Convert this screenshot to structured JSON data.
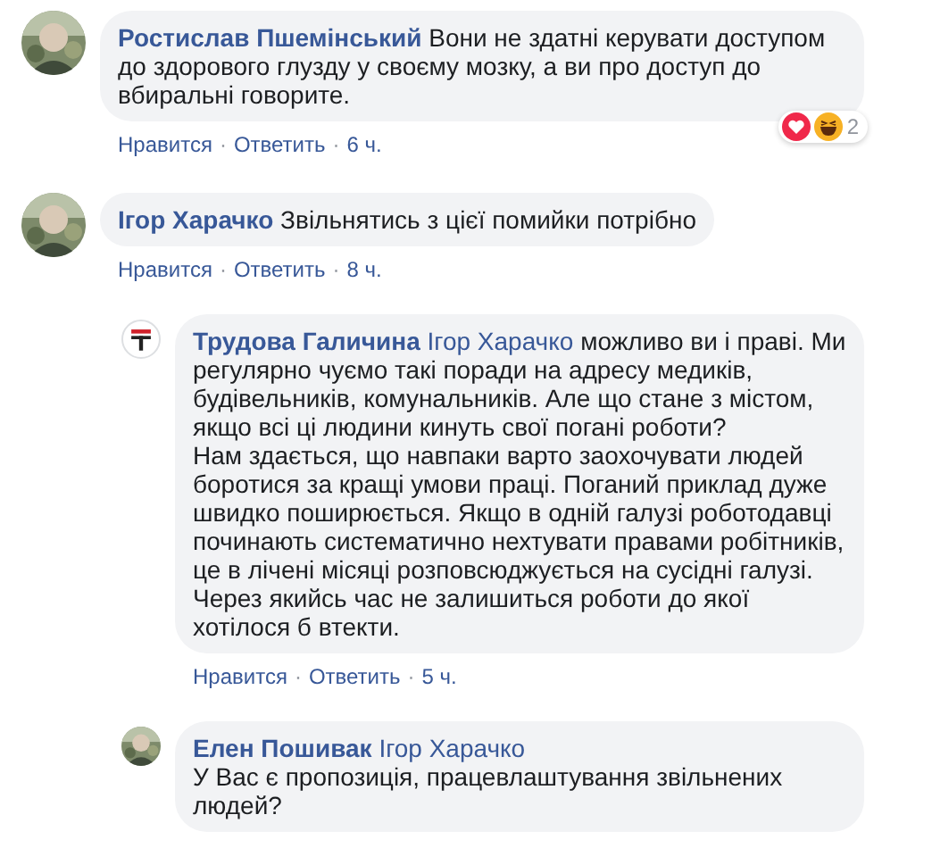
{
  "comments": [
    {
      "author": "Ростислав Пшемінський",
      "avatar": {
        "kind": "picture"
      },
      "paragraphs": [
        "Вони не здатні керувати доступом до здорового глузду у своєму мозку, а ви про доступ до вбиральні говорите."
      ],
      "actions": [
        "Нравится",
        "Ответить"
      ],
      "separator": "·",
      "time": "6 ч.",
      "reactions": {
        "count": "2"
      }
    },
    {
      "author": "Ігор Харачко",
      "avatar": {
        "kind": "picture"
      },
      "paragraphs": [
        "Звільнятись з цієї помийки потрібно"
      ],
      "actions": [
        "Нравится",
        "Ответить"
      ],
      "separator": "·",
      "time": "8 ч.",
      "replies": [
        {
          "author": "Трудова Галичина",
          "avatar": {
            "kind": "logo"
          },
          "mention": "Ігор Харачко",
          "paragraphs": [
            "можливо ви і праві. Ми регулярно чуємо такі поради на адресу медиків, будівельників, комунальників. Але що стане з містом, якщо всі ці людини кинуть свої погані роботи?",
            "Нам здається, що навпаки варто заохочувати людей боротися за кращі умови праці. Поганий приклад дуже швидко поширюється. Якщо в одній галузі роботодавці починають систематично нехтувати правами робітників, це в лічені місяці розповсюджується на сусідні галузі. Через якийсь час не залишиться роботи до якої хотілося б втекти."
          ],
          "actions": [
            "Нравится",
            "Ответить"
          ],
          "separator": "·",
          "time": "5 ч."
        },
        {
          "author": "Елен Пошивак",
          "avatar": {
            "kind": "picture"
          },
          "mention": "Ігор Харачко",
          "mention_break": true,
          "paragraphs": [
            "У Вас є пропозиція, працевлаштування звільнених людей?"
          ]
        }
      ]
    }
  ]
}
